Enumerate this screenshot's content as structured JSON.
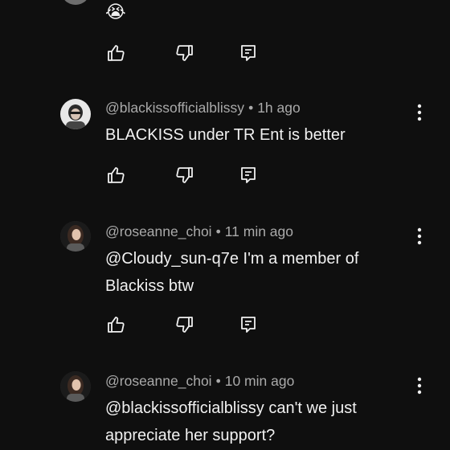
{
  "top_comment": {
    "emoji": "😭"
  },
  "comments": [
    {
      "handle": "@blackissofficialblissy",
      "separator": "•",
      "time": "1h ago",
      "lines": [
        "BLACKISS under TR Ent is better"
      ]
    },
    {
      "handle": "@roseanne_choi",
      "separator": "•",
      "time": "11 min ago",
      "lines": [
        "@Cloudy_sun-q7e I'm a member of",
        "Blackiss btw"
      ]
    },
    {
      "handle": "@roseanne_choi",
      "separator": "•",
      "time": "10 min ago",
      "lines": [
        "@blackissofficialblissy can't we just",
        "appreciate her support?"
      ]
    }
  ],
  "icons": {
    "like": "thumbs-up-icon",
    "dislike": "thumbs-down-icon",
    "reply": "reply-comment-icon",
    "more": "more-vert-icon"
  }
}
